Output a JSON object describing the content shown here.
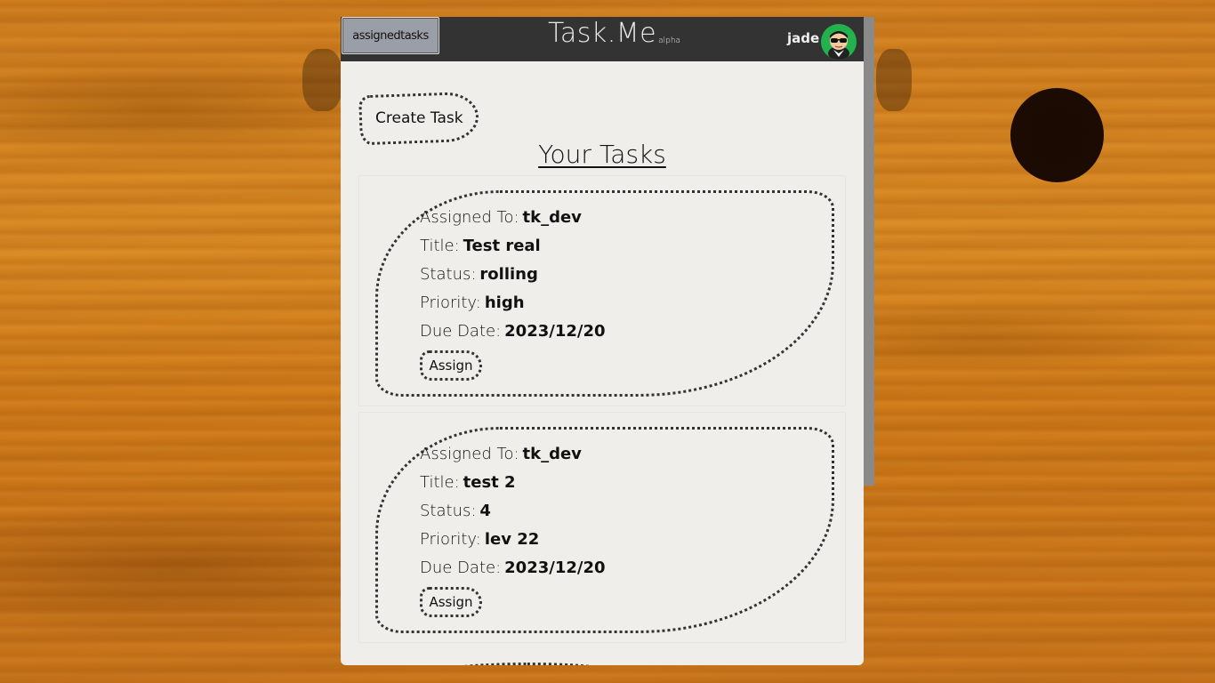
{
  "header": {
    "nav_button_label": "assignedtasks",
    "brand_name": "Task.Me",
    "brand_tag": "alpha",
    "username": "jade"
  },
  "main": {
    "create_task_label": "Create Task",
    "section_title": "Your Tasks",
    "tasks": [
      {
        "assigned_to_label": "Assigned To:",
        "assigned_to": "tk_dev",
        "title_label": "Title:",
        "title": "Test real",
        "status_label": "Status:",
        "status": "rolling",
        "priority_label": "Priority:",
        "priority": "high",
        "due_date_label": "Due Date:",
        "due_date": "2023/12/20",
        "assign_label": "Assign"
      },
      {
        "assigned_to_label": "Assigned To:",
        "assigned_to": "tk_dev",
        "title_label": "Title:",
        "title": "test 2",
        "status_label": "Status:",
        "status": "4",
        "priority_label": "Priority:",
        "priority": "lev 22",
        "due_date_label": "Due Date:",
        "due_date": "2023/12/20",
        "assign_label": "Assign"
      }
    ]
  },
  "colors": {
    "header_bg": "#333333",
    "paper_bg": "#f0eeea",
    "rule_line": "#a9b4d8",
    "avatar_bg": "#22b14c",
    "wood": "#d07e1e"
  },
  "icons": {
    "avatar": "user-avatar-sunglasses-icon"
  }
}
